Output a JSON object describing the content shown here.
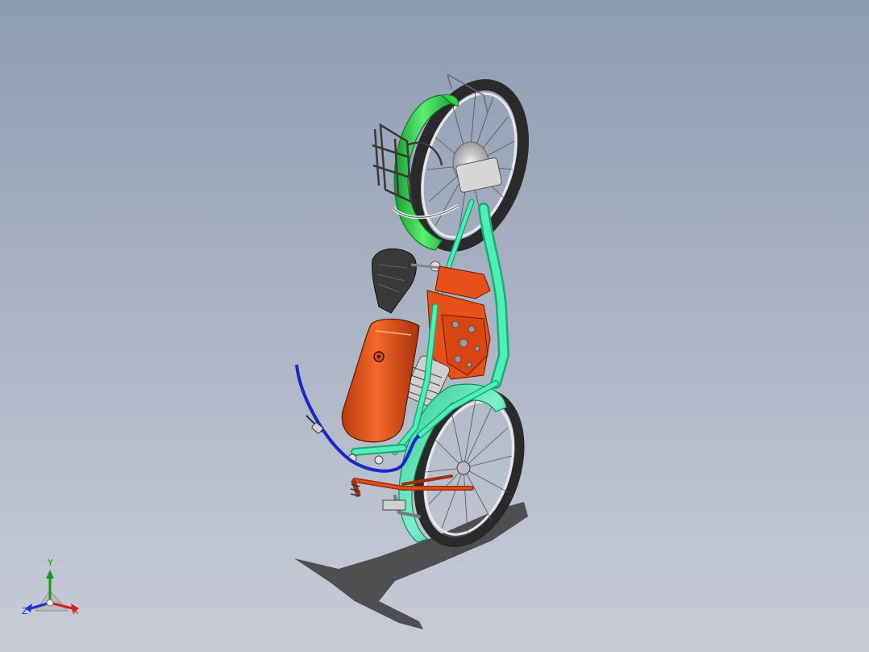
{
  "viewport": {
    "background_top": "#8e9cb2",
    "background_bottom": "#c7ccd6"
  },
  "model": {
    "colors": {
      "frame": "#3ee0a8",
      "front_fender": "#2fd24a",
      "engine": "#e8501a",
      "fuel_tank": "#e8501a",
      "cable": "#2030d8",
      "tire": "#2a2a2a",
      "spokes": "#4a4a4a",
      "seat": "#3a3a3a"
    }
  },
  "triad": {
    "x_label": "X",
    "y_label": "Y",
    "z_label": "Z",
    "x_color": "#d42020",
    "y_color": "#1a9a1a",
    "z_color": "#2030d0"
  }
}
